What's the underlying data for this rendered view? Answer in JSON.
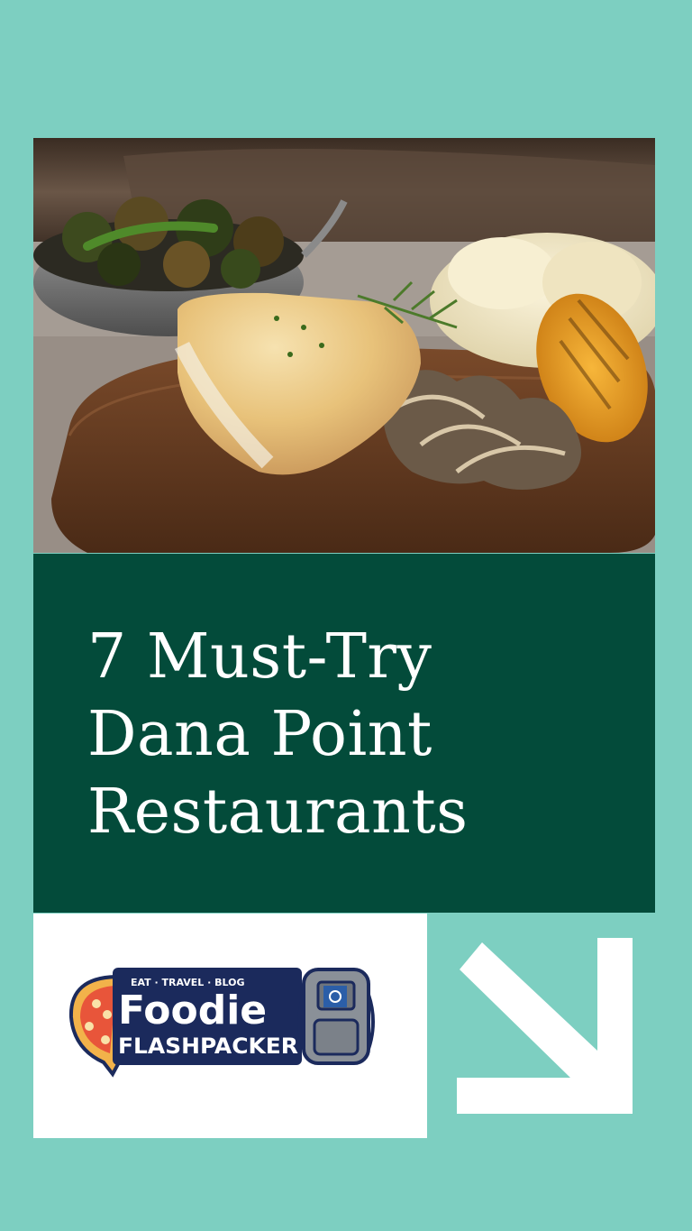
{
  "photo": {
    "alt_subject": "plated fish with mashed potatoes, grilled lemon and brussels sprouts"
  },
  "title": {
    "line1": "7 Must-Try",
    "line2": "Dana Point",
    "line3": "Restaurants"
  },
  "logo": {
    "tagline": "EAT · TRAVEL · BLOG",
    "word1": "Foodie",
    "word2": "FLASHPACKER",
    "icons": [
      "pizza-icon",
      "backpack-icon"
    ]
  },
  "colors": {
    "background": "#7dcfc1",
    "title_panel": "#034b3a",
    "title_text": "#ffffff",
    "logo_blue": "#1b2a5c",
    "pizza_red": "#d8412b"
  },
  "arrow": {
    "icon": "arrow-down-right-icon"
  }
}
